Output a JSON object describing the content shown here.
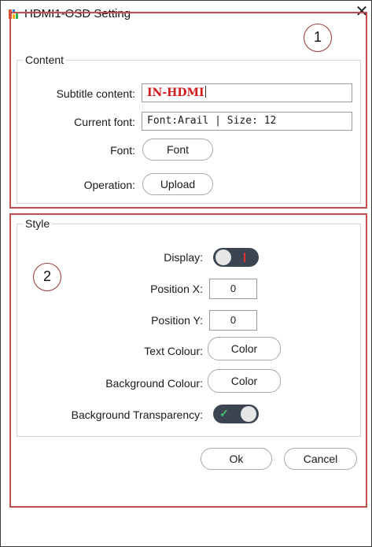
{
  "window": {
    "title": "HDMI1-OSD Setting",
    "close_glyph": "✕"
  },
  "callouts": {
    "one": "1",
    "two": "2"
  },
  "content": {
    "legend": "Content",
    "subtitle_label": "Subtitle content:",
    "subtitle_value": "IN-HDMI",
    "current_font_label": "Current font:",
    "current_font_value": "Font:Arail | Size: 12",
    "font_label": "Font:",
    "font_button": "Font",
    "operation_label": "Operation:",
    "upload_button": "Upload"
  },
  "style": {
    "legend": "Style",
    "display_label": "Display:",
    "display_on": false,
    "position_x_label": "Position X:",
    "position_x_value": "0",
    "position_y_label": "Position Y:",
    "position_y_value": "0",
    "text_colour_label": "Text Colour:",
    "text_colour_button": "Color",
    "bg_colour_label": "Background Colour:",
    "bg_colour_button": "Color",
    "bg_transparency_label": "Background Transparency:",
    "bg_transparency_on": true
  },
  "footer": {
    "ok_label": "Ok",
    "cancel_label": "Cancel"
  },
  "colors": {
    "callout_border": "#c0504d",
    "subtitle_text": "#d11a1a",
    "toggle_bg": "#3b4450",
    "toggle_check": "#3cc86a"
  },
  "icons": {
    "app": "app-logo-icon",
    "close": "close-icon",
    "toggle_check": "check-icon"
  }
}
